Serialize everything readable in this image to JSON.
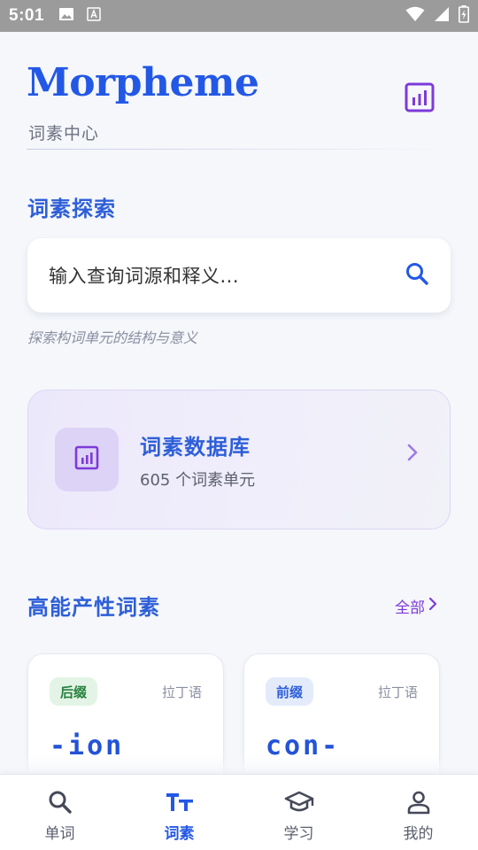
{
  "status_bar": {
    "time": "5:01"
  },
  "header": {
    "title": "Morpheme",
    "subtitle": "词素中心"
  },
  "explore": {
    "title": "词素探索",
    "search_placeholder": "输入查询词源和释义...",
    "hint": "探索构词单元的结构与意义"
  },
  "database_card": {
    "title": "词素数据库",
    "subtitle": "605 个词素单元"
  },
  "productive": {
    "title": "高能产性词素",
    "see_all": "全部",
    "cards": [
      {
        "badge": "后缀",
        "language": "拉丁语",
        "morpheme": "-ion"
      },
      {
        "badge": "前缀",
        "language": "拉丁语",
        "morpheme": "con-"
      }
    ]
  },
  "bottom_nav": {
    "items": [
      {
        "label": "单词",
        "icon": "search-icon"
      },
      {
        "label": "词素",
        "icon": "text-size-icon"
      },
      {
        "label": "学习",
        "icon": "graduation-cap-icon"
      },
      {
        "label": "我的",
        "icon": "person-icon"
      }
    ],
    "active_index": 1
  },
  "colors": {
    "primary_blue": "#2358e6",
    "accent_purple": "#7d3ad8",
    "suffix_green": "#26803d",
    "card_bg": "#ece8fb"
  }
}
